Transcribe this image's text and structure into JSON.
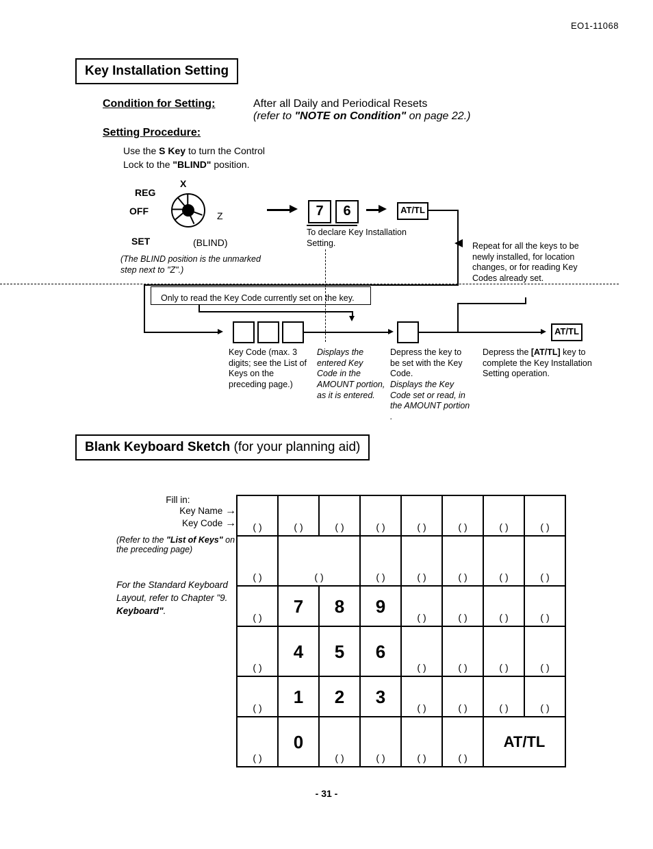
{
  "doc_code": "EO1-11068",
  "section1_title": "Key Installation Setting",
  "cond_label": "Condition for Setting:",
  "cond_line1": "After all Daily and Periodical Resets",
  "cond_line2a": "(refer to ",
  "cond_line2b": "\"NOTE on Condition\"",
  "cond_line2c": " on page 22.)",
  "proc_label": "Setting Procedure:",
  "proc_text_a": "Use the ",
  "proc_text_b": "S Key",
  "proc_text_c": " to turn the Control Lock to the ",
  "proc_text_d": "\"BLIND\"",
  "proc_text_e": " position.",
  "dial": {
    "x": "X",
    "reg": "REG",
    "off": "OFF",
    "z": "Z",
    "set": "SET",
    "blind": "(BLIND)"
  },
  "dial_note": "(The BLIND position is the unmarked step next to \"Z\".)",
  "k7": "7",
  "k6": "6",
  "attl": "AT/TL",
  "declare": "To declare Key Installation Setting.",
  "repeat": "Repeat for all the keys to be newly installed, for location changes, or for reading Key Codes already set.",
  "onlyread": "Only to read the Key Code currently set on the key.",
  "cap1": "Key Code (max. 3 digits; see the List of Keys on the preceding page.)",
  "cap2": "Displays the entered Key Code in the AMOUNT portion, as it is entered.",
  "cap3a": "Depress the key to be set with the Key Code.",
  "cap3b": "Displays the Key Code set or read, in the AMOUNT portion .",
  "cap4a": "Depress the ",
  "cap4b": "[AT/TL]",
  "cap4c": " key to complete the Key Installation Setting operation.",
  "section2_title_a": "Blank Keyboard Sketch ",
  "section2_title_b": "(for your planning aid)",
  "fillin": "Fill in:",
  "keyname": "Key Name",
  "keycode": "Key Code",
  "refnote_a": "(Refer to the ",
  "refnote_b": "\"List of Keys\"",
  "refnote_c": " on the preceding page)",
  "stdnote_a": "For the Standard Keyboard Layout, refer to Chapter \"9. ",
  "stdnote_b": "Keyboard\"",
  "stdnote_c": ".",
  "paren": "(        )",
  "kb": {
    "n0": "0",
    "n1": "1",
    "n2": "2",
    "n3": "3",
    "n4": "4",
    "n5": "5",
    "n6": "6",
    "n7": "7",
    "n8": "8",
    "n9": "9",
    "attl": "AT/TL"
  },
  "pagenum": "- 31 -"
}
